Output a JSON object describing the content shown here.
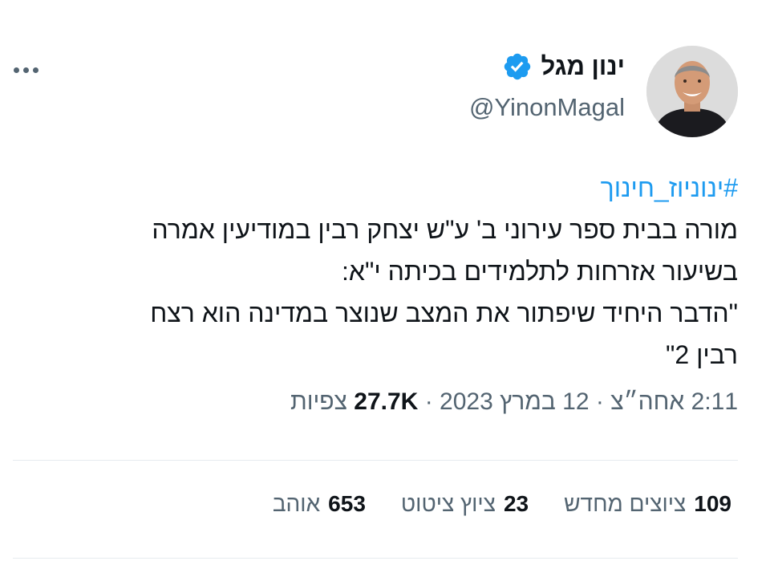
{
  "user": {
    "display_name": "ינון מגל",
    "handle": "@YinonMagal",
    "avatar_icon": "person-avatar",
    "verified": true
  },
  "tweet": {
    "hashtag": "#ינוניוז_חינוך",
    "lines": [
      "מורה בבית ספר עירוני ב' ע\"ש יצחק רבין במודיעין אמרה",
      "בשיעור אזרחות לתלמידים בכיתה י\"א:",
      "\"הדבר היחיד שיפתור את המצב שנוצר במדינה הוא רצח",
      "רבין 2\""
    ]
  },
  "meta": {
    "time": "2:11 אחה״צ",
    "date": "12 במרץ 2023",
    "separator": "·",
    "views_count": "27.7K",
    "views_label": "צפיות"
  },
  "stats": {
    "retweets_count": "109",
    "retweets_label": "ציוצים מחדש",
    "quotes_count": "23",
    "quotes_label": "ציוץ ציטוט",
    "likes_count": "653",
    "likes_label": "אוהב"
  },
  "colors": {
    "accent": "#1d9bf0",
    "secondary_text": "#536471",
    "divider": "#e6ebef"
  }
}
